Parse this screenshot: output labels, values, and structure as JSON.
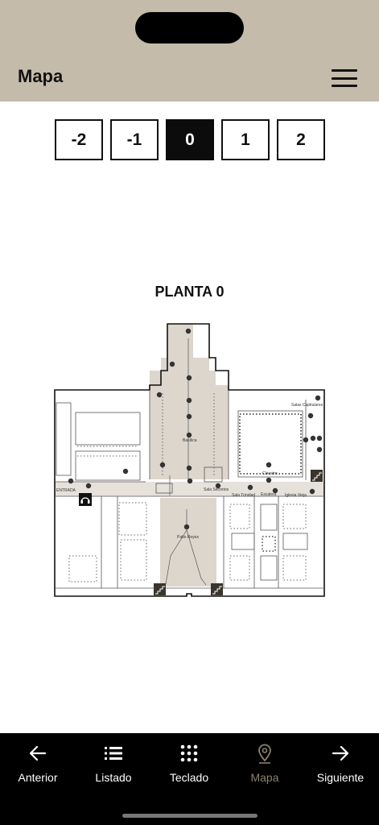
{
  "header": {
    "title": "Mapa"
  },
  "floors": [
    "-2",
    "-1",
    "0",
    "1",
    "2"
  ],
  "active_floor": "0",
  "plan_title": "PLANTA 0",
  "map_labels": {
    "entrance": "ENTRADA",
    "basilica": "Basílica",
    "patio": "Patio Reyes",
    "sala_capitulares": "Salas Capitulares",
    "claustro": "Claustro",
    "sala_secretos": "Sala Secretos",
    "sala_trinidad": "Sala Trinidad",
    "escalera": "Escalera",
    "iglesia_vieja": "Iglesia Vieja"
  },
  "tabs": [
    {
      "label": "Anterior",
      "icon": "arrow-left-icon"
    },
    {
      "label": "Listado",
      "icon": "list-icon"
    },
    {
      "label": "Teclado",
      "icon": "keypad-icon"
    },
    {
      "label": "Mapa",
      "icon": "map-pin-icon"
    },
    {
      "label": "Siguiente",
      "icon": "arrow-right-icon"
    }
  ],
  "colors": {
    "header": "#c5bbab",
    "tabbar": "#000000",
    "active_tab": "#8c8170",
    "map_fill": "#dcd6cd"
  }
}
